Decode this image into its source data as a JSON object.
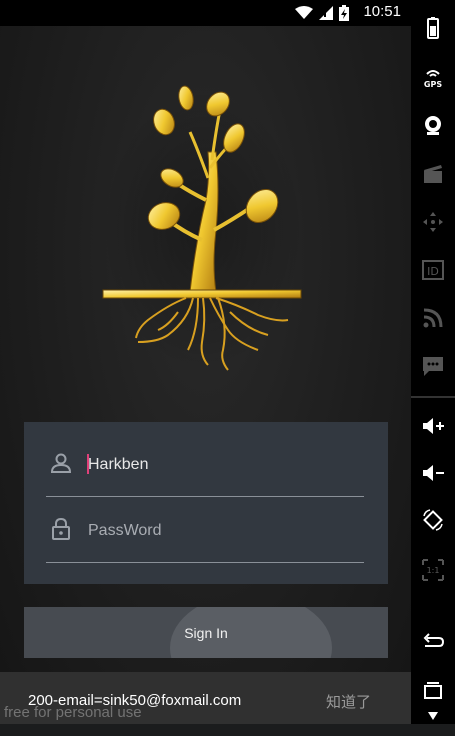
{
  "status_bar": {
    "time": "10:51"
  },
  "login": {
    "username_value": "Harkben",
    "password_placeholder": "PassWord",
    "sign_in_label": "Sign In"
  },
  "toast": {
    "message": "200-email=sink50@foxmail.com",
    "action_label": "知道了"
  },
  "watermark": "free for personal use",
  "emulator_sidebar": {
    "gps_label": "GPS",
    "id_label": "ID",
    "scale_label": "1:1",
    "items": [
      "battery-icon",
      "gps-icon",
      "camera-icon",
      "clapperboard-icon",
      "dpad-icon",
      "id-icon",
      "rss-icon",
      "sms-icon",
      "volume-up-icon",
      "volume-down-icon",
      "rotate-icon",
      "scale-icon",
      "back-icon",
      "recents-icon"
    ]
  },
  "colors": {
    "accent_caret": "#e0407a",
    "card": "#323840",
    "button": "#474b51",
    "gold": "#e8c030"
  }
}
